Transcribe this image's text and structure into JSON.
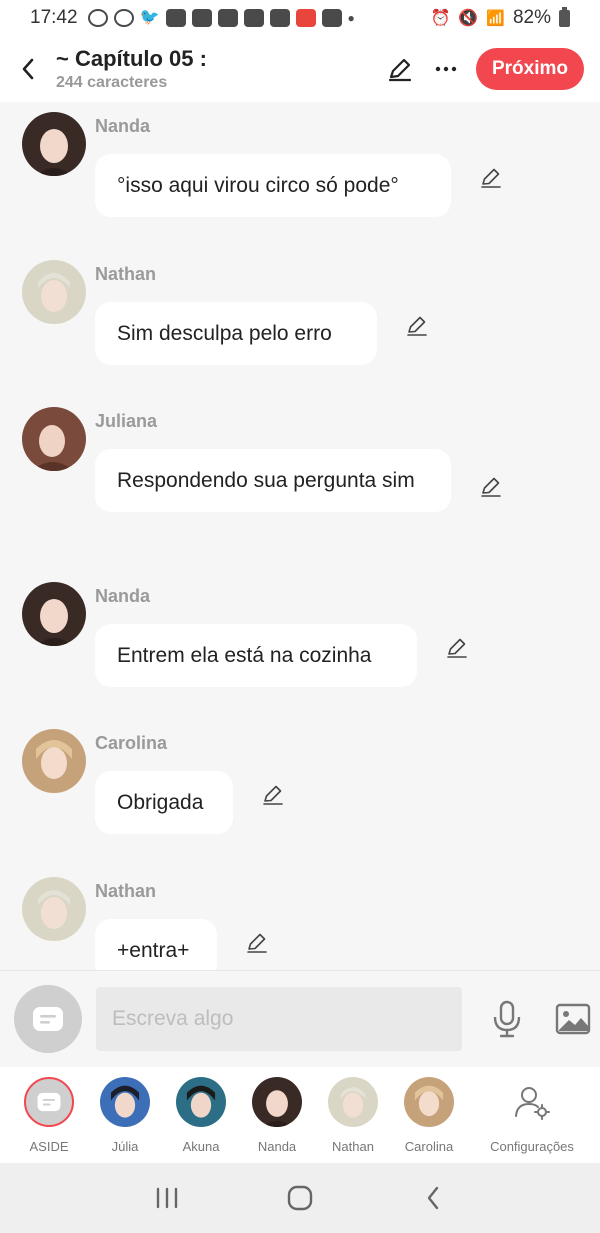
{
  "status_bar": {
    "time": "17:42",
    "battery": "82%"
  },
  "header": {
    "title": "~ Capítulo 05 :",
    "subtitle": "244 caracteres",
    "next_label": "Próximo"
  },
  "messages": [
    {
      "name": "Nanda",
      "text": "°isso aqui virou circo só pode°"
    },
    {
      "name": "Nathan",
      "text": "Sim desculpa pelo erro"
    },
    {
      "name": "Juliana",
      "text": "Respondendo sua pergunta sim"
    },
    {
      "name": "Nanda",
      "text": "Entrem ela está na cozinha"
    },
    {
      "name": "Carolina",
      "text": "Obrigada"
    },
    {
      "name": "Nathan",
      "text": "+entra+"
    }
  ],
  "composer": {
    "placeholder": "Escreva algo"
  },
  "characters": [
    {
      "label": "ASIDE"
    },
    {
      "label": "Júlia"
    },
    {
      "label": "Akuna"
    },
    {
      "label": "Nanda"
    },
    {
      "label": "Nathan"
    },
    {
      "label": "Carolina"
    },
    {
      "label": "Configurações"
    }
  ],
  "colors": {
    "accent": "#f2474f",
    "background": "#f6f6f6",
    "bubble": "#ffffff",
    "name_text": "#9a9a9a",
    "avatar_nanda": "#3a2a26",
    "avatar_nathan": "#d9d6c6",
    "avatar_juliana": "#7a4a3c",
    "avatar_carolina": "#c6a27a"
  }
}
